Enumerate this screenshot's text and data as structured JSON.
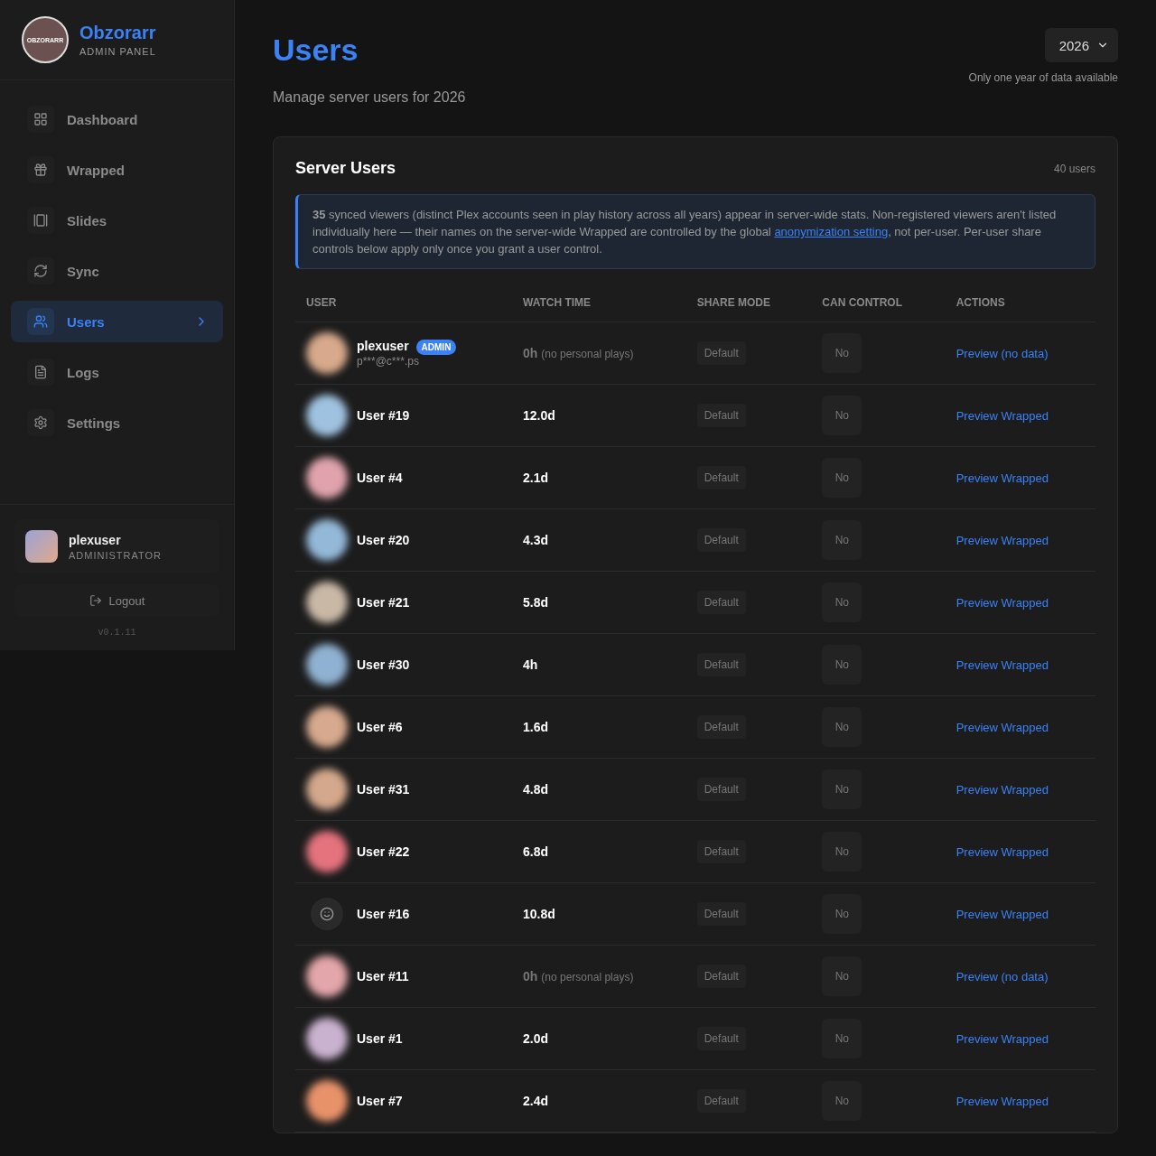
{
  "brand": {
    "name": "Obzorarr",
    "subtitle": "ADMIN PANEL",
    "logo_text": "OBZORARR"
  },
  "nav": [
    {
      "label": "Dashboard",
      "selected": false
    },
    {
      "label": "Wrapped",
      "selected": false
    },
    {
      "label": "Slides",
      "selected": false
    },
    {
      "label": "Sync",
      "selected": false
    },
    {
      "label": "Users",
      "selected": true
    },
    {
      "label": "Logs",
      "selected": false
    },
    {
      "label": "Settings",
      "selected": false
    }
  ],
  "account": {
    "name": "plexuser",
    "role": "ADMINISTRATOR",
    "logout": "Logout",
    "version": "v0.1.11"
  },
  "page": {
    "title": "Users",
    "subtitle": "Manage server users for 2026",
    "year": "2026",
    "year_note": "Only one year of data available"
  },
  "card": {
    "title": "Server Users",
    "count": "40 users",
    "notice_count": "35",
    "notice_text": " synced viewers (distinct Plex accounts seen in play history across all years) appear in server-wide stats. Non-registered viewers aren't listed individually here — their names on the server-wide Wrapped are controlled by the global ",
    "notice_link": "anonymization setting",
    "notice_tail": ", not per-user. Per-user share controls below apply only once you grant a user control."
  },
  "table": {
    "columns": [
      "USER",
      "WATCH TIME",
      "SHARE MODE",
      "CAN CONTROL",
      "ACTIONS"
    ],
    "rows": [
      {
        "name": "plexuser",
        "badge": "ADMIN",
        "email": "p***@c***.ps",
        "kind": "photo",
        "color": "#d8a98c",
        "watch": "0h",
        "watch_note": "(no personal plays)",
        "share": "Default",
        "control": "No",
        "action": "Preview (no data)"
      },
      {
        "name": "User #19",
        "kind": "photo",
        "color": "#9fc2e0",
        "watch": "12.0d",
        "share": "Default",
        "control": "No",
        "action": "Preview Wrapped"
      },
      {
        "name": "User #4",
        "kind": "photo",
        "color": "#e0a3ad",
        "watch": "2.1d",
        "share": "Default",
        "control": "No",
        "action": "Preview Wrapped"
      },
      {
        "name": "User #20",
        "kind": "photo",
        "color": "#94b8d8",
        "watch": "4.3d",
        "share": "Default",
        "control": "No",
        "action": "Preview Wrapped"
      },
      {
        "name": "User #21",
        "kind": "photo",
        "color": "#c9b8a6",
        "watch": "5.8d",
        "share": "Default",
        "control": "No",
        "action": "Preview Wrapped"
      },
      {
        "name": "User #30",
        "kind": "photo",
        "color": "#8fb2d2",
        "watch": "4h",
        "share": "Default",
        "control": "No",
        "action": "Preview Wrapped"
      },
      {
        "name": "User #6",
        "kind": "photo",
        "color": "#d7a98e",
        "watch": "1.6d",
        "share": "Default",
        "control": "No",
        "action": "Preview Wrapped"
      },
      {
        "name": "User #31",
        "kind": "photo",
        "color": "#d4a88c",
        "watch": "4.8d",
        "share": "Default",
        "control": "No",
        "action": "Preview Wrapped"
      },
      {
        "name": "User #22",
        "kind": "photo",
        "color": "#e4737d",
        "watch": "6.8d",
        "share": "Default",
        "control": "No",
        "action": "Preview Wrapped"
      },
      {
        "name": "User #16",
        "kind": "icon",
        "color": "#2a2a2a",
        "watch": "10.8d",
        "share": "Default",
        "control": "No",
        "action": "Preview Wrapped"
      },
      {
        "name": "User #11",
        "kind": "photo",
        "color": "#e3a6aa",
        "watch": "0h",
        "watch_note": "(no personal plays)",
        "share": "Default",
        "control": "No",
        "action": "Preview (no data)"
      },
      {
        "name": "User #1",
        "kind": "photo",
        "color": "#c9b2cf",
        "watch": "2.0d",
        "share": "Default",
        "control": "No",
        "action": "Preview Wrapped"
      },
      {
        "name": "User #7",
        "kind": "photo",
        "color": "#e8926a",
        "watch": "2.4d",
        "share": "Default",
        "control": "No",
        "action": "Preview Wrapped"
      }
    ]
  }
}
